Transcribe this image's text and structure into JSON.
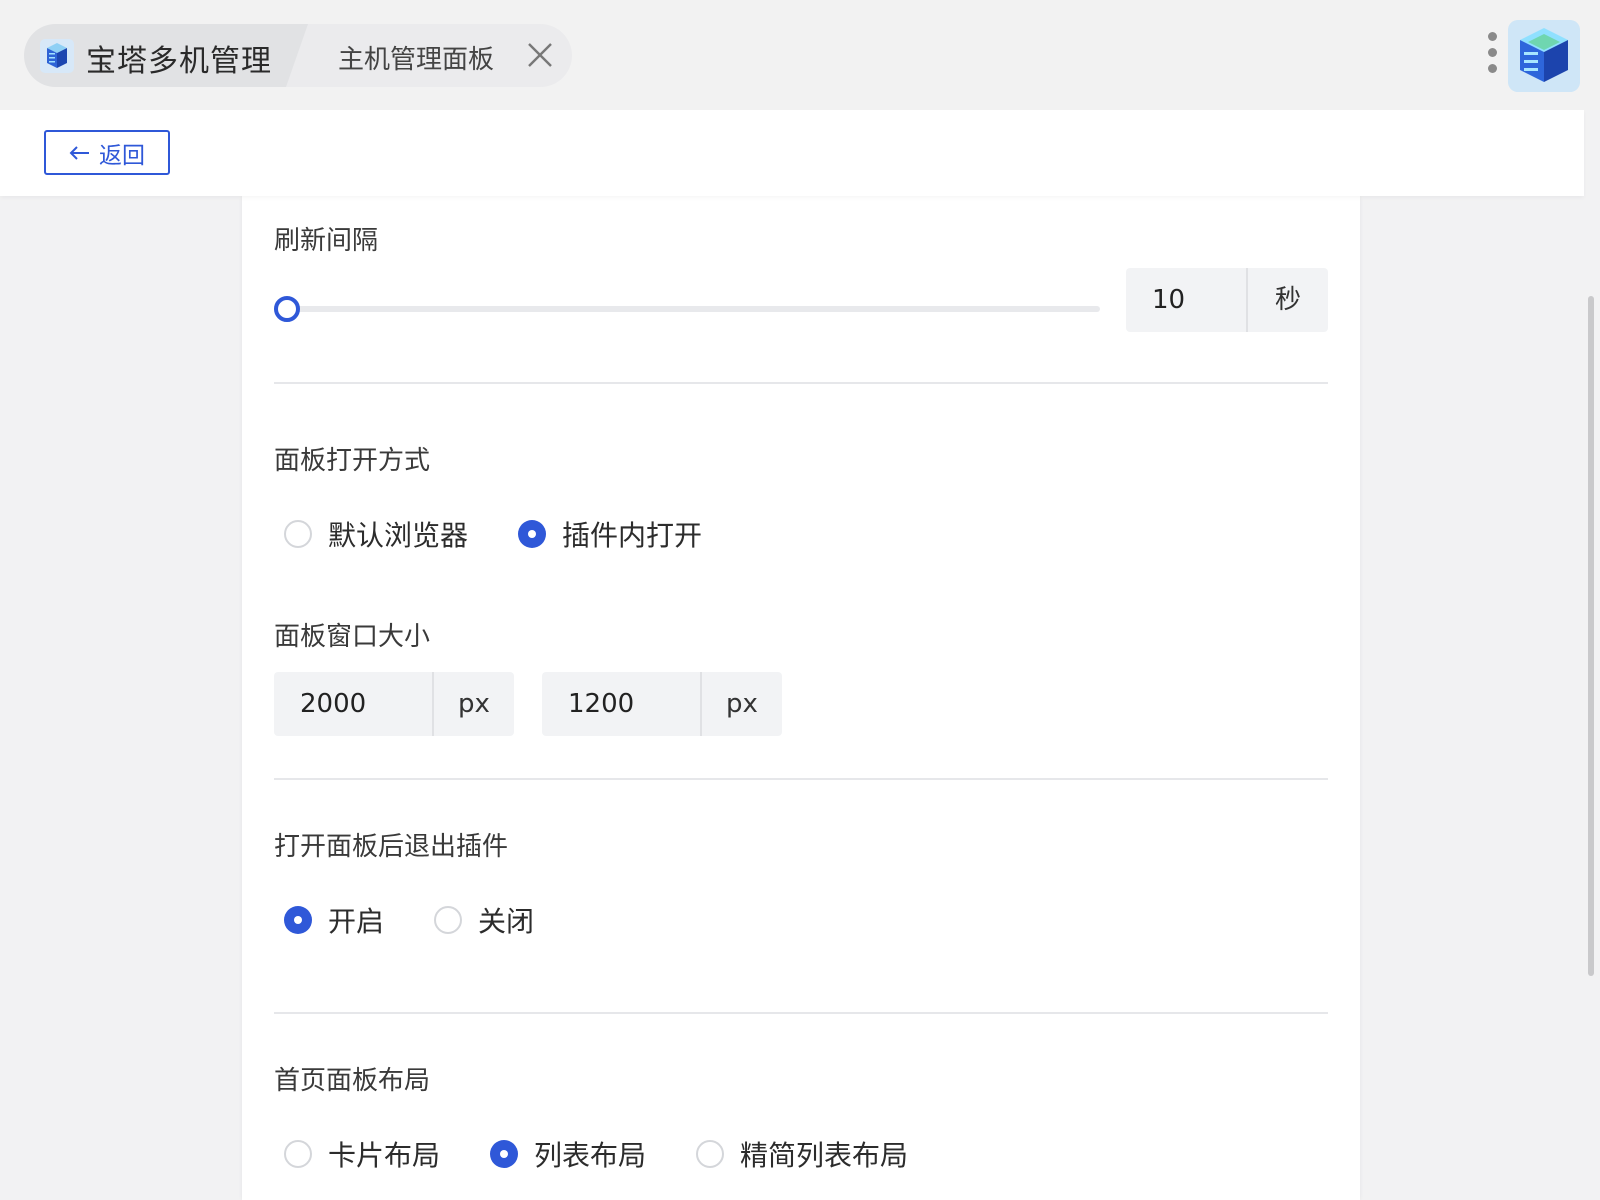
{
  "tabs": {
    "main_title": "宝塔多机管理",
    "sub_title": "主机管理面板"
  },
  "nav": {
    "back_label": "返回"
  },
  "refresh": {
    "label": "刷新间隔",
    "value": "10",
    "unit": "秒",
    "slider_fraction": 0.0
  },
  "open_mode": {
    "label": "面板打开方式",
    "options": [
      "默认浏览器",
      "插件内打开"
    ],
    "selected": "插件内打开"
  },
  "window_size": {
    "label": "面板窗口大小",
    "width_value": "2000",
    "width_unit": "px",
    "height_value": "1200",
    "height_unit": "px"
  },
  "exit_after_open": {
    "label": "打开面板后退出插件",
    "options": [
      "开启",
      "关闭"
    ],
    "selected": "开启"
  },
  "home_layout": {
    "label": "首页面板布局",
    "options": [
      "卡片布局",
      "列表布局",
      "精简列表布局"
    ],
    "selected": "列表布局"
  },
  "colors": {
    "accent": "#2f58d8",
    "background": "#f2f2f3",
    "input_bg": "#f2f3f5"
  },
  "icons": [
    "bt-logo-icon",
    "close-icon",
    "more-vertical-icon",
    "app-server-icon",
    "arrow-left-icon"
  ]
}
